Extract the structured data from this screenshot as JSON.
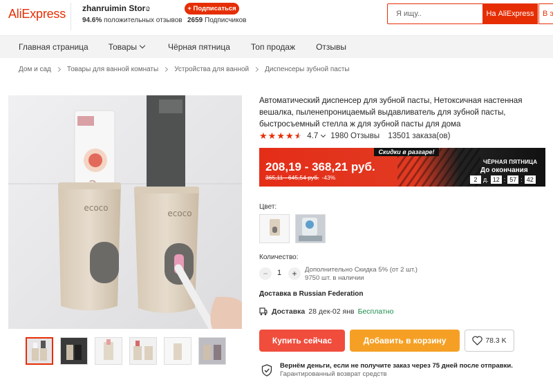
{
  "header": {
    "logo": "AliExpress",
    "store_name": "zhanruimin Store",
    "rating_percent": "94.6%",
    "rating_text": "положительных отзывов",
    "subscribe_label": "+ Подписаться",
    "subscribers_count": "2659",
    "subscribers_text": "Подписчиков",
    "search_placeholder": "Я ищу..",
    "search_ali_label": "На AliExpress",
    "search_store_label": "В этом магазине"
  },
  "nav": {
    "items": [
      "Главная страница",
      "Товары",
      "Чёрная пятница",
      "Топ продаж",
      "Отзывы"
    ]
  },
  "breadcrumb": [
    "Дом и сад",
    "Товары для ванной комнаты",
    "Устройства для ванной",
    "Диспенсеры зубной пасты"
  ],
  "product": {
    "title": "Автоматический диспенсер для зубной пасты, Нетоксичная настенная вешалка, пыленепроницаемый выдавливатель для зубной пасты, быстросъемный стелла ж для зубной пасты для дома",
    "rating": "4.7",
    "reviews": "1980 Отзывы",
    "orders": "13501 заказа(ов)",
    "stars": 4.5,
    "image_brand_text": "ecoco"
  },
  "price": {
    "sale_tag": "Скидки в разгаре!",
    "current": "208,19 - 368,21 руб.",
    "old": "365,11 - 645,54 руб.",
    "discount": "-43%",
    "event": "ЧЁРНАЯ ПЯТНИЦА",
    "until": "До окончания",
    "timer": {
      "days": "2",
      "days_label": "д.",
      "hours": "12",
      "minutes": "57",
      "seconds": "42"
    }
  },
  "options": {
    "color_label": "Цвет:",
    "quantity_label": "Количество:",
    "quantity_value": "1",
    "quantity_minus": "−",
    "quantity_plus": "+",
    "quantity_note_1": "Дополнительно Скидка 5% (от 2 шт.)",
    "quantity_note_2": "9750 шт. в наличии"
  },
  "shipping": {
    "ship_to": "Доставка в Russian Federation",
    "delivery_label": "Доставка",
    "delivery_dates": "28 дек-02 янв",
    "delivery_cost": "Бесплатно"
  },
  "actions": {
    "buy": "Купить сейчас",
    "cart": "Добавить в корзину",
    "wishlist_count": "78.3 K"
  },
  "guarantee": {
    "title": "Вернём деньги, если не получите заказ через 75 дней после отправки.",
    "subtitle": "Гарантированный возврат средств"
  },
  "colors": {
    "brand": "#e62e04",
    "buy": "#f04d3d",
    "cart": "#f5a025",
    "free": "#1a8b4a"
  }
}
